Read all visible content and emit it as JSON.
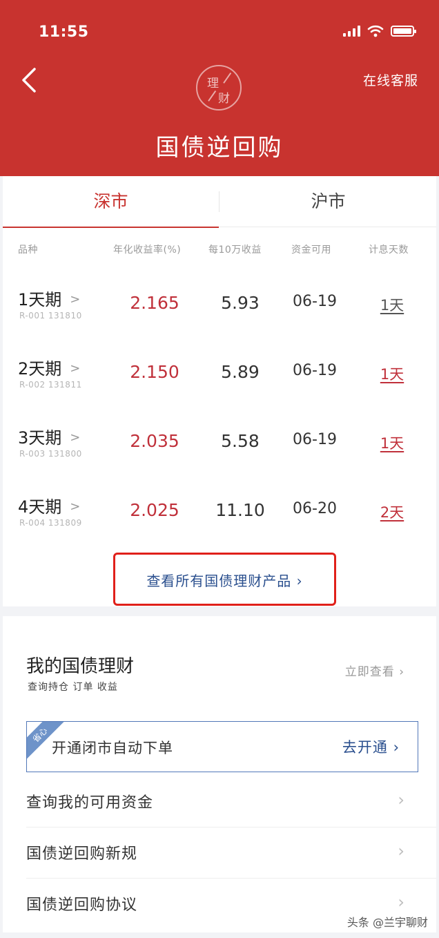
{
  "status_bar": {
    "time": "11:55"
  },
  "header": {
    "logo_text_1": "理",
    "logo_text_2": "财",
    "title": "国债逆回购",
    "service": "在线客服"
  },
  "tabs": [
    {
      "label": "深市",
      "active": true
    },
    {
      "label": "沪市",
      "active": false
    }
  ],
  "table": {
    "headers": [
      "品种",
      "年化收益率(%)",
      "每10万收益",
      "资金可用",
      "计息天数"
    ],
    "rows": [
      {
        "name": "1天期",
        "code": "R-001 131810",
        "rate": "2.165",
        "profit": "5.93",
        "available": "06-19",
        "days": "1天"
      },
      {
        "name": "2天期",
        "code": "R-002 131811",
        "rate": "2.150",
        "profit": "5.89",
        "available": "06-19",
        "days": "1天"
      },
      {
        "name": "3天期",
        "code": "R-003 131800",
        "rate": "2.035",
        "profit": "5.58",
        "available": "06-19",
        "days": "1天"
      },
      {
        "name": "4天期",
        "code": "R-004 131809",
        "rate": "2.025",
        "profit": "11.10",
        "available": "06-20",
        "days": "2天"
      }
    ],
    "view_all": "查看所有国债理财产品 ›"
  },
  "my_section": {
    "title": "我的国债理财",
    "subtitle": "查询持仓 订单 收益",
    "link": "立即查看 ›"
  },
  "auto_order": {
    "badge": "省心",
    "text": "开通闭市自动下单",
    "button": "去开通 ›"
  },
  "menu": [
    {
      "label": "查询我的可用资金"
    },
    {
      "label": "国债逆回购新规"
    },
    {
      "label": "国债逆回购协议"
    }
  ],
  "watermark": "头条 @兰宇聊财",
  "colors": {
    "brand_red": "#c8332f",
    "link_blue": "#2a4f8e",
    "highlight_box": "#e0201a"
  }
}
